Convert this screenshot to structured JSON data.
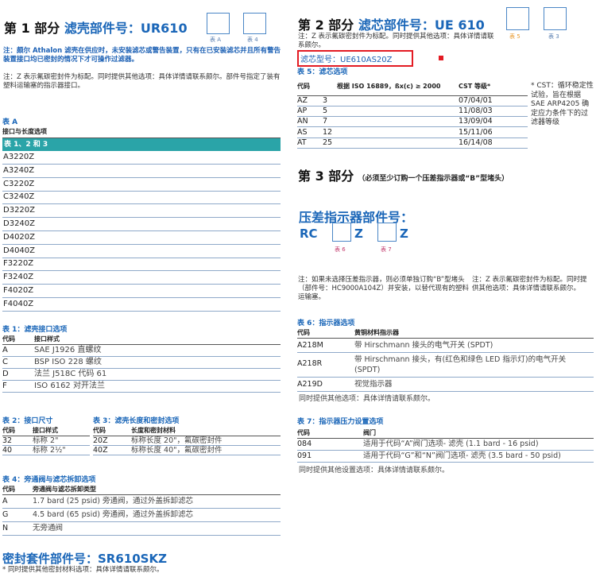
{
  "left": {
    "title_prefix": "第 1 部分",
    "title_blue": "滤壳部件号：UR610",
    "box_a_label": "表 A",
    "box_4_label": "表 4",
    "notice": "注：颇尔 Athalon 滤壳在供应时，未安装滤芯或警告装置，只有在已安装滤芯并且所有警告装置接口均已密封的情况下才可操作过滤器。",
    "z_note": "注：Z 表示氟碳密封件为标配。同时提供其他选项：具体详情请联系颇尔。部件号指定了装有塑料运输塞的指示器接口。",
    "table_a": {
      "title": "表 A",
      "header": "接口与长度选项",
      "band": "表 1、2 和 3",
      "rows": [
        "A3220Z",
        "A3240Z",
        "C3220Z",
        "C3240Z",
        "D3220Z",
        "D3240Z",
        "D4020Z",
        "D4040Z",
        "F3220Z",
        "F3240Z",
        "F4020Z",
        "F4040Z"
      ]
    },
    "table1": {
      "title": "表 1：滤壳接口选项",
      "h_code": "代码",
      "h_style": "接口样式",
      "rows": [
        {
          "code": "A",
          "desc": "SAE J1926 直螺纹"
        },
        {
          "code": "C",
          "desc": "BSP ISO 228 螺纹"
        },
        {
          "code": "D",
          "desc": "法兰 J518C 代码 61"
        },
        {
          "code": "F",
          "desc": "ISO 6162 对开法兰"
        }
      ]
    },
    "table2": {
      "title": "表 2：接口尺寸",
      "h_code": "代码",
      "h_style": "接口样式",
      "rows": [
        {
          "code": "32",
          "desc": "标称 2\""
        },
        {
          "code": "40",
          "desc": "标称 2½\""
        }
      ]
    },
    "table3": {
      "title": "表 3：滤壳长度和密封选项",
      "h_code": "代码",
      "h_desc": "长度和密封材料",
      "rows": [
        {
          "code": "20Z",
          "desc": "标称长度 20\"，氟碳密封件"
        },
        {
          "code": "40Z",
          "desc": "标称长度 40\"，氟碳密封件"
        }
      ]
    },
    "table4": {
      "title": "表 4：旁通阀与滤芯拆卸选项",
      "h_code": "代码",
      "h_desc": "旁通阀与滤芯拆卸类型",
      "rows": [
        {
          "code": "A",
          "desc": "1.7 bard (25 psid) 旁通阀，通过外盖拆卸滤芯"
        },
        {
          "code": "G",
          "desc": "4.5 bard (65 psid) 旁通阀，通过外盖拆卸滤芯"
        },
        {
          "code": "N",
          "desc": "无旁通阀"
        }
      ]
    },
    "seal_title": "密封套件部件号：SR610SKZ",
    "seal_note": "* 同时提供其他密封材料选项：具体详情请联系颇尔。"
  },
  "right": {
    "title_prefix": "第 2 部分",
    "title_blue": "滤芯部件号：UE 610",
    "box_5_label": "表 5",
    "box_3_label": "表 3",
    "z_note": "注：Z 表示氟碳密封件为标配。同时提供其他选项：具体详情请联系颇尔。",
    "highlight": "滤芯型号：UE610AS20Z",
    "table5": {
      "title": "表 5：滤芯选项",
      "h_code": "代码",
      "h_beta": "根据 ISO 16889，ßx(c) ≥ 2000",
      "h_cst": "CST 等级*",
      "rows": [
        {
          "code": "AZ",
          "beta": "3",
          "cst": "07/04/01"
        },
        {
          "code": "AP",
          "beta": "5",
          "cst": "11/08/03"
        },
        {
          "code": "AN",
          "beta": "7",
          "cst": "13/09/04"
        },
        {
          "code": "AS",
          "beta": "12",
          "cst": "15/11/06"
        },
        {
          "code": "AT",
          "beta": "25",
          "cst": "16/14/08"
        }
      ],
      "cst_note": "* CST：循环稳定性试验，旨在根据 SAE ARP4205 确定应力条件下的过滤器等级"
    },
    "part3_title": "第 3 部分",
    "part3_sub": "（必须至少订购一个压差指示器或“B”型堵头）",
    "indicator_title": "压差指示器部件号：",
    "rc": "RC",
    "z1": "Z",
    "z2": "Z",
    "box_6_label": "表 6",
    "box_7_label": "表 7",
    "note_left": "注：如果未选择压差指示器，则必须单独订购“B”型堵头（部件号：HC9000A104Z）并安装，以替代现有的塑料运输塞。",
    "note_right": "注：Z 表示氟碳密封件为标配。同时提供其他选项：具体详情请联系颇尔。",
    "table6": {
      "title": "表 6：指示器选项",
      "h_code": "代码",
      "h_desc": "黄铜材料指示器",
      "rows": [
        {
          "code": "A218M",
          "desc": "带 Hirschmann 接头的电气开关 (SPDT)"
        },
        {
          "code": "A218R",
          "desc": "带 Hirschmann 接头，有(红色和绿色 LED 指示灯)的电气开关 (SPDT)"
        },
        {
          "code": "A219D",
          "desc": "视觉指示器"
        }
      ],
      "note": "同时提供其他选项：具体详情请联系颇尔。"
    },
    "table7": {
      "title": "表 7：指示器压力设置选项",
      "h_code": "代码",
      "h_desc": "阀门",
      "rows": [
        {
          "code": "084",
          "desc": "适用于代码“A”阀门选项- 滤壳 (1.1 bard - 16 psid)"
        },
        {
          "code": "091",
          "desc": "适用于代码“G”和“N”阀门选项- 滤壳 (3.5 bard - 50 psid)"
        }
      ],
      "note": "同时提供其他设置选项：具体详情请联系颇尔。"
    }
  }
}
